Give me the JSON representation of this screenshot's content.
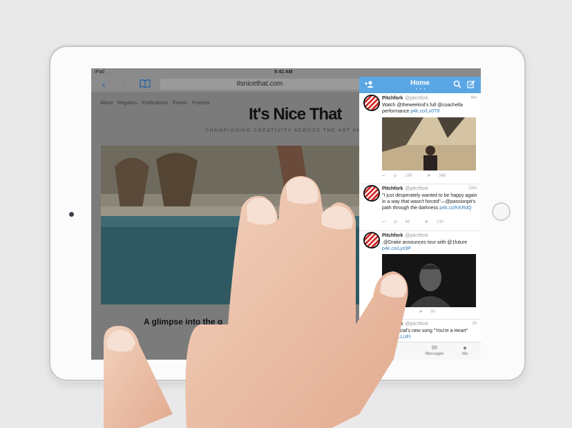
{
  "status": {
    "device": "iPad",
    "time": "9:41 AM"
  },
  "safari": {
    "url": "itsnicethat.com",
    "nav": [
      "About",
      "Regulars",
      "Publications",
      "Events",
      "Projects"
    ],
    "site_title": "It's Nice That",
    "tagline": "CHAMPIONING CREATIVITY ACROSS THE ART AND DESIGN WO",
    "headline": "A glimpse into the g"
  },
  "twitter": {
    "title": "Home",
    "tweets": [
      {
        "name": "Pitchfork",
        "handle": "@pitchfork",
        "time": "8m",
        "text": "Watch @theweeknd's full @coachella performance ",
        "link": "p4k.co/Lv0T8",
        "retweets": "199",
        "favorites": "348"
      },
      {
        "name": "Pitchfork",
        "handle": "@pitchfork",
        "time": "22m",
        "text": "\"I just desperately wanted to be happy again in a way that wasn't forced\"—@passionpit's path through the darkness ",
        "link": "p4k.co/KKRdQ",
        "retweets": "56",
        "favorites": "130"
      },
      {
        "name": "Pitchfork",
        "handle": "@pitchfork",
        "time": "",
        "text": ".@Drake announces tour with @1future ",
        "link": "p4k.co/Lys9P",
        "retweets": "",
        "favorites": "90"
      },
      {
        "name": "Pitchfork",
        "handle": "@pitchfork",
        "time": "1h",
        "text": "@bluofficial's new song \"You're a Heart\" ",
        "link": "p4k.co/LLUFI",
        "retweets": "",
        "favorites": ""
      }
    ],
    "tabs": [
      "tifications",
      "Messages",
      "Me"
    ]
  }
}
